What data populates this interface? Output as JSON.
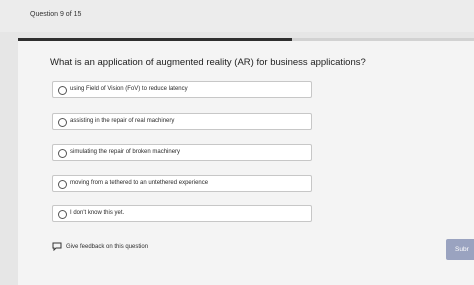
{
  "header": {
    "progress_label": "Question 9 of 15"
  },
  "progress": {
    "fraction": 0.6
  },
  "question": {
    "text": "What is an application of augmented reality (AR) for business applications?",
    "options": [
      {
        "label": "using Field of Vision (FoV) to reduce latency",
        "selected": false
      },
      {
        "label": "assisting in the repair of real machinery",
        "selected": false
      },
      {
        "label": "simulating the repair of broken machinery",
        "selected": false
      },
      {
        "label": "moving from a tethered to an untethered experience",
        "selected": false
      },
      {
        "label": "I don't know this yet.",
        "selected": false
      }
    ]
  },
  "footer": {
    "feedback_label": "Give feedback on this question",
    "feedback_icon": "chat-bubble-icon",
    "submit_label": "Subr"
  },
  "colors": {
    "submit_bg": "#9aa3c0",
    "progress_fill": "#2f2f2f"
  }
}
